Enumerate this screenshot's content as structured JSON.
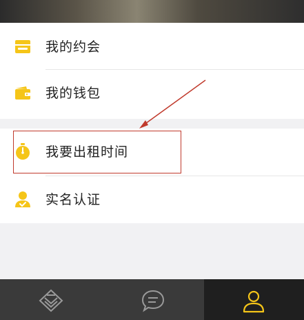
{
  "menu": {
    "items": [
      {
        "label": "我的约会",
        "icon": "calendar-card-icon"
      },
      {
        "label": "我的钱包",
        "icon": "wallet-icon"
      },
      {
        "label": "我要出租时间",
        "icon": "stopwatch-icon"
      },
      {
        "label": "实名认证",
        "icon": "verified-user-icon"
      }
    ]
  },
  "bottom_nav": {
    "tabs": [
      {
        "icon": "brand-logo-icon",
        "active": false
      },
      {
        "icon": "chat-bubble-icon",
        "active": false
      },
      {
        "icon": "person-icon",
        "active": true
      }
    ]
  },
  "colors": {
    "accent": "#f5c518",
    "annotation": "#c0392b",
    "tabbar_bg": "#3a3a3a",
    "tab_active_bg": "#1f1f1f"
  }
}
